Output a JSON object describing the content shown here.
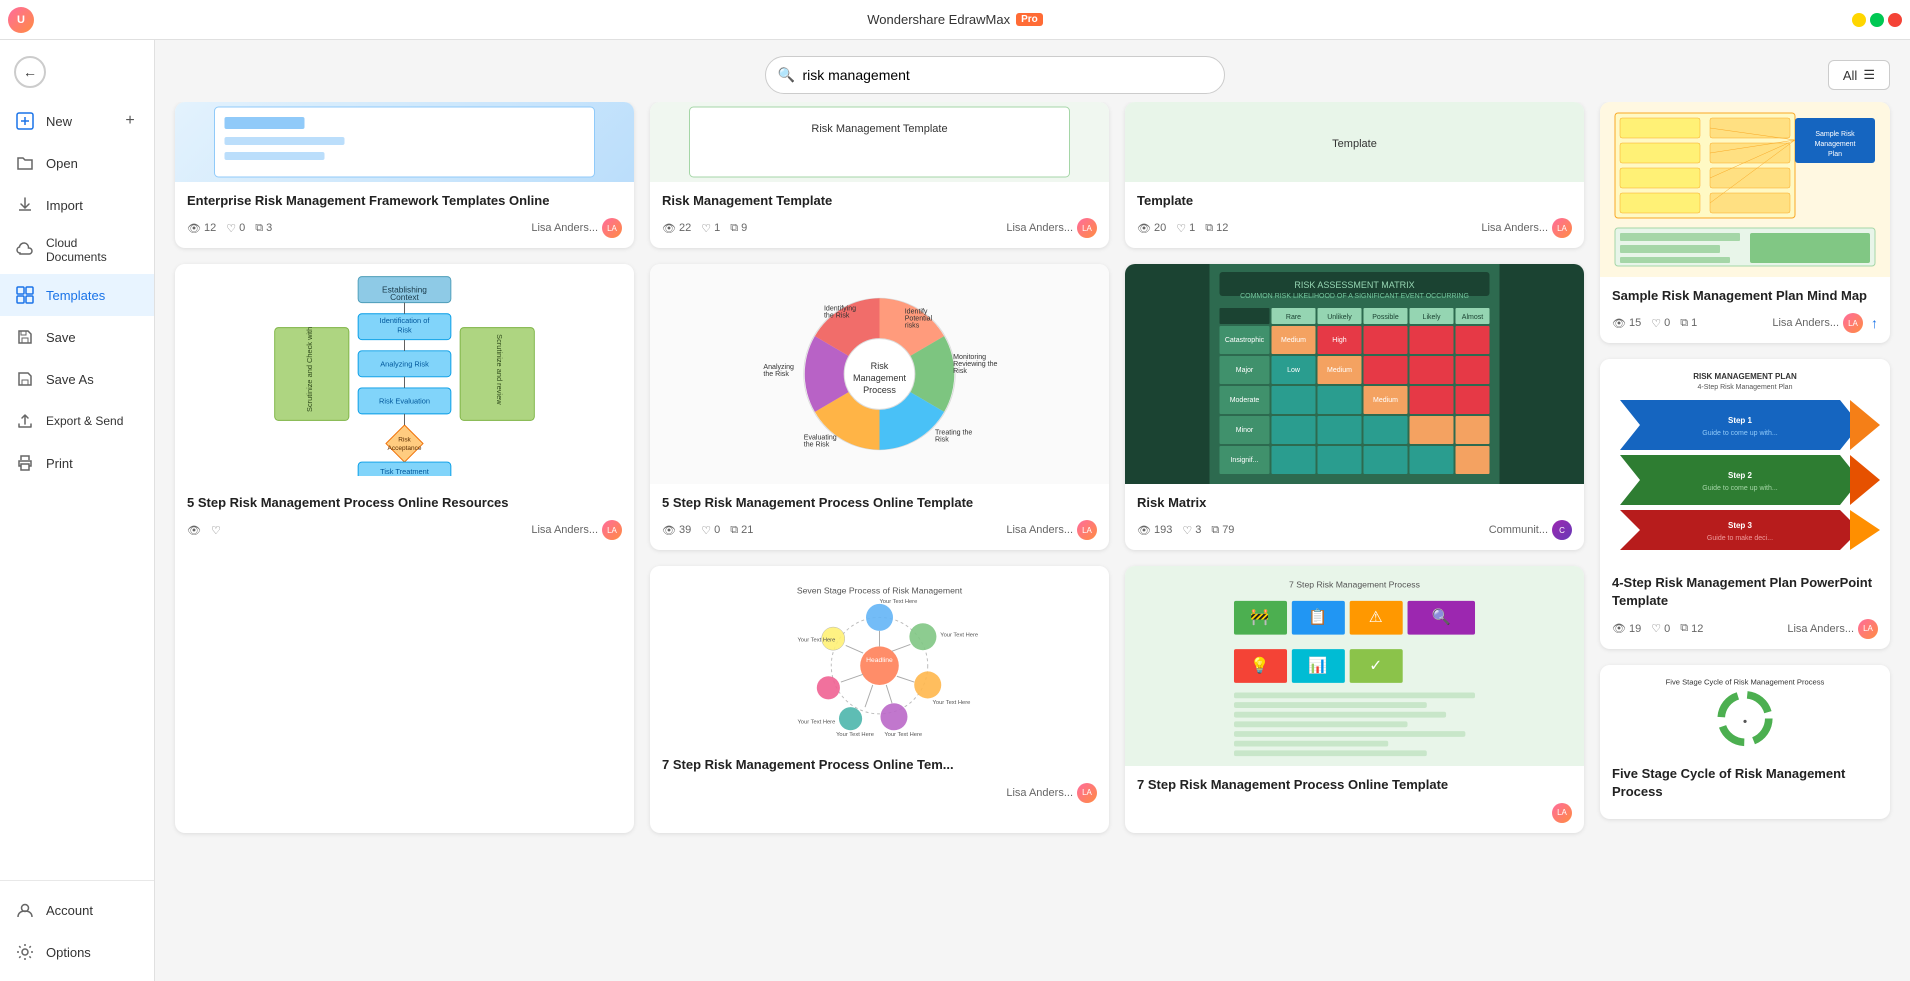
{
  "app": {
    "title": "Wondershare EdrawMax",
    "pro_badge": "Pro"
  },
  "titlebar": {
    "minimize": "—",
    "maximize": "❐",
    "close": "✕"
  },
  "toolbar": {
    "all_label": "All",
    "search_value": "risk management"
  },
  "sidebar": {
    "new_label": "New",
    "open_label": "Open",
    "import_label": "Import",
    "cloud_label": "Cloud Documents",
    "templates_label": "Templates",
    "save_label": "Save",
    "save_as_label": "Save As",
    "export_label": "Export & Send",
    "print_label": "Print",
    "account_label": "Account",
    "options_label": "Options"
  },
  "templates": [
    {
      "id": 1,
      "title": "Enterprise Risk Management Framework Templates Online",
      "views": "12",
      "likes": "0",
      "copies": "3",
      "author": "Lisa Anders...",
      "col": 1,
      "thumb_type": "enterprise"
    },
    {
      "id": 2,
      "title": "5 Step Risk Management Process Online Template",
      "views": "39",
      "likes": "0",
      "copies": "21",
      "author": "Lisa Anders...",
      "col": 2,
      "thumb_type": "5step_process"
    },
    {
      "id": 3,
      "title": "Risk Matrix",
      "views": "193",
      "likes": "3",
      "copies": "79",
      "author": "Communit...",
      "col": 3,
      "thumb_type": "risk_matrix",
      "is_community": true
    },
    {
      "id": 4,
      "title": "5 Step Risk Management Process Online Resources",
      "views": "",
      "likes": "",
      "copies": "",
      "author": "Lisa Anders...",
      "col": 1,
      "thumb_type": "5step_resources"
    },
    {
      "id": 5,
      "title": "7 Step Risk Management Process Online Tem...",
      "views": "",
      "likes": "",
      "copies": "",
      "author": "Lisa Anders...",
      "col": 2,
      "thumb_type": "7step_online_template"
    },
    {
      "id": 6,
      "title": "7 Step Risk Management Process Online Template",
      "views": "",
      "likes": "",
      "copies": "",
      "author": "",
      "col": 3,
      "thumb_type": "7step_process"
    }
  ],
  "right_column_templates": [
    {
      "id": 7,
      "title": "Sample Risk Management Plan Mind Map",
      "views": "15",
      "likes": "0",
      "copies": "1",
      "author": "Lisa Anders...",
      "thumb_type": "sample_plan"
    },
    {
      "id": 8,
      "title": "4-Step Risk Management Plan PowerPoint Template",
      "views": "19",
      "likes": "0",
      "copies": "12",
      "author": "Lisa Anders...",
      "thumb_type": "4step"
    },
    {
      "id": 9,
      "title": "Five Stage Cycle of Risk Management Process",
      "views": "",
      "likes": "",
      "copies": "",
      "author": "",
      "thumb_type": "five_stage"
    }
  ],
  "top_partial_templates": [
    {
      "id": 10,
      "title": "...(partial top) Template",
      "views": "22",
      "likes": "1",
      "copies": "9",
      "author": "Lisa Anders..."
    },
    {
      "id": 11,
      "title": "...(partial top)",
      "views": "20",
      "likes": "1",
      "copies": "12",
      "author": "Lisa Anders..."
    }
  ]
}
